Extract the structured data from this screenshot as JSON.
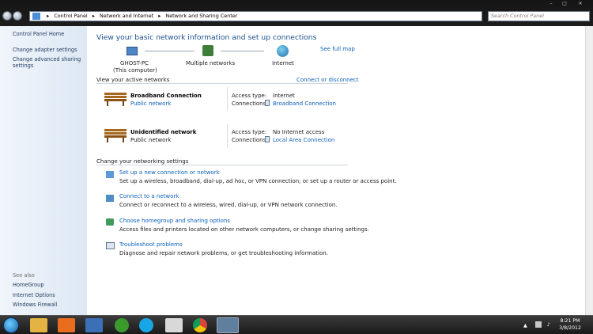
{
  "address": {
    "crumbs": [
      "Control Panel",
      "Network and Internet",
      "Network and Sharing Center"
    ],
    "search_placeholder": "Search Control Panel"
  },
  "sidebar": {
    "items": [
      "Control Panel Home",
      "Change adapter settings",
      "Change advanced sharing settings"
    ],
    "see_also_label": "See also",
    "see_also": [
      "HomeGroup",
      "Internet Options",
      "Windows Firewall"
    ]
  },
  "main": {
    "title": "View your basic network information and set up connections",
    "see_full_map": "See full map",
    "map": {
      "computer_name": "GHOST-PC",
      "computer_sub": "(This computer)",
      "middle": "Multiple networks",
      "internet": "Internet"
    },
    "active_label": "View your active networks",
    "connect_disconnect": "Connect or disconnect",
    "networks": [
      {
        "name": "Broadband Connection",
        "type": "Public network",
        "access_label": "Access type:",
        "access": "Internet",
        "connections_label": "Connections:",
        "connection": "Broadband Connection"
      },
      {
        "name": "Unidentified network",
        "type": "Public network",
        "access_label": "Access type:",
        "access": "No Internet access",
        "connections_label": "Connections:",
        "connection": "Local Area Connection"
      }
    ],
    "change_label": "Change your networking settings",
    "tasks": [
      {
        "title": "Set up a new connection or network",
        "desc": "Set up a wireless, broadband, dial-up, ad hoc, or VPN connection; or set up a router or access point."
      },
      {
        "title": "Connect to a network",
        "desc": "Connect or reconnect to a wireless, wired, dial-up, or VPN network connection."
      },
      {
        "title": "Choose homegroup and sharing options",
        "desc": "Access files and printers located on other network computers, or change sharing settings."
      },
      {
        "title": "Troubleshoot problems",
        "desc": "Diagnose and repair network problems, or get troubleshooting information."
      }
    ]
  },
  "taskbar": {
    "time": "8:21 PM",
    "date": "3/8/2012"
  }
}
